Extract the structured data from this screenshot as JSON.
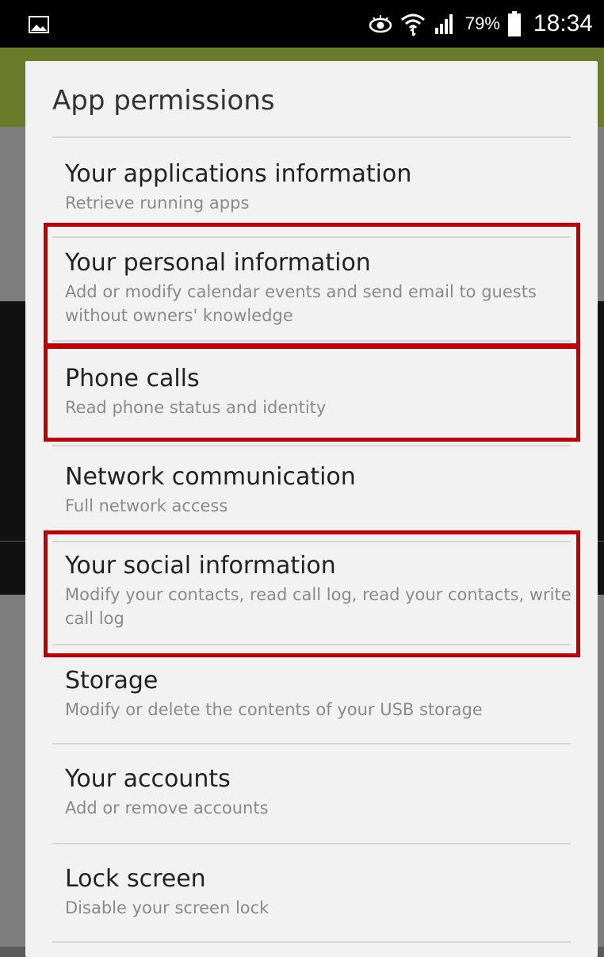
{
  "status_bar": {
    "battery_percent": "79%",
    "time": "18:34",
    "icons": [
      "image-icon",
      "eye-icon",
      "wifi-icon",
      "signal-icon",
      "battery-icon"
    ]
  },
  "dialog": {
    "title": "App permissions",
    "permissions": [
      {
        "title": "Your applications information",
        "desc": "Retrieve running apps"
      },
      {
        "title": "Your personal information",
        "desc": "Add or modify calendar events and send email to guests without owners' knowledge"
      },
      {
        "title": "Phone calls",
        "desc": "Read phone status and identity"
      },
      {
        "title": "Network communication",
        "desc": "Full network access"
      },
      {
        "title": "Your social information",
        "desc": "Modify your contacts, read call log, read your contacts, write call log"
      },
      {
        "title": "Storage",
        "desc": "Modify or delete the contents of your USB storage"
      },
      {
        "title": "Your accounts",
        "desc": "Add or remove accounts"
      },
      {
        "title": "Lock screen",
        "desc": "Disable your screen lock"
      }
    ]
  },
  "highlight_color": "#c00000"
}
